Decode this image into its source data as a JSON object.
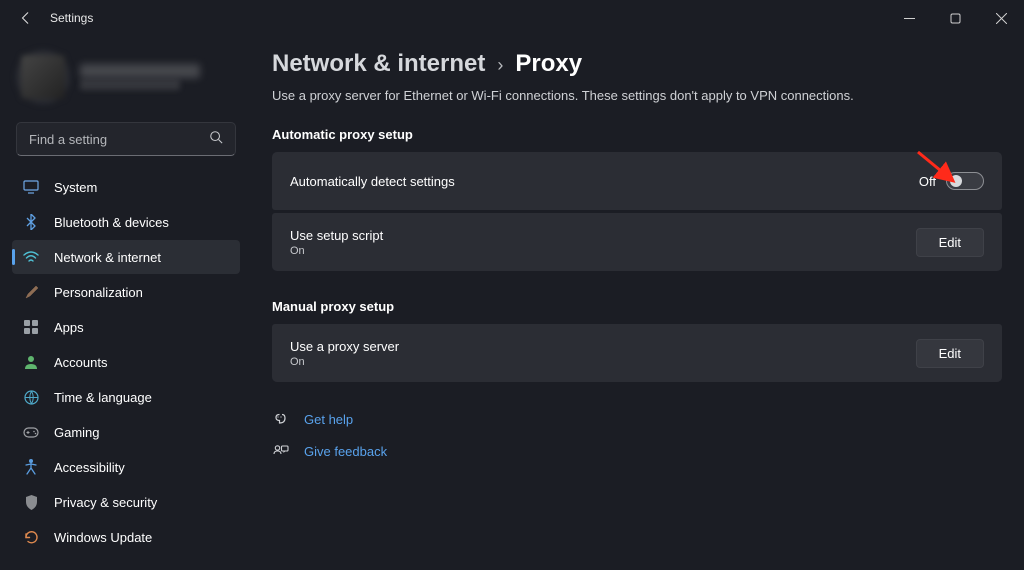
{
  "window": {
    "title": "Settings"
  },
  "search": {
    "placeholder": "Find a setting"
  },
  "nav": {
    "items": [
      {
        "icon": "system",
        "label": "System",
        "selected": false
      },
      {
        "icon": "bluetooth",
        "label": "Bluetooth & devices",
        "selected": false
      },
      {
        "icon": "network",
        "label": "Network & internet",
        "selected": true
      },
      {
        "icon": "personalize",
        "label": "Personalization",
        "selected": false
      },
      {
        "icon": "apps",
        "label": "Apps",
        "selected": false
      },
      {
        "icon": "accounts",
        "label": "Accounts",
        "selected": false
      },
      {
        "icon": "time",
        "label": "Time & language",
        "selected": false
      },
      {
        "icon": "gaming",
        "label": "Gaming",
        "selected": false
      },
      {
        "icon": "accessibility",
        "label": "Accessibility",
        "selected": false
      },
      {
        "icon": "privacy",
        "label": "Privacy & security",
        "selected": false
      },
      {
        "icon": "update",
        "label": "Windows Update",
        "selected": false
      }
    ]
  },
  "breadcrumb": {
    "parent": "Network & internet",
    "current": "Proxy"
  },
  "page": {
    "subtitle": "Use a proxy server for Ethernet or Wi-Fi connections. These settings don't apply to VPN connections.",
    "section1_header": "Automatic proxy setup",
    "auto_detect": {
      "title": "Automatically detect settings",
      "state_label": "Off"
    },
    "setup_script": {
      "title": "Use setup script",
      "sub": "On",
      "button": "Edit"
    },
    "section2_header": "Manual proxy setup",
    "proxy_server": {
      "title": "Use a proxy server",
      "sub": "On",
      "button": "Edit"
    },
    "help_link": "Get help",
    "feedback_link": "Give feedback"
  },
  "colors": {
    "accent": "#59a2ec",
    "bg": "#1b1d24",
    "card": "#2b2d34"
  }
}
